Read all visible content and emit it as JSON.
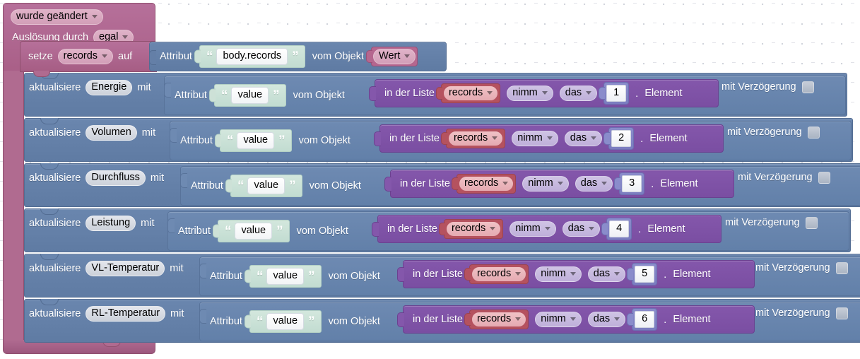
{
  "editor": {
    "type": "blockly-workspace",
    "language": "de",
    "grid_spacing_px": 28,
    "colors": {
      "hat_block": "#b06b90",
      "attribute_block": "#657fa8",
      "list_block": "#7d51a5",
      "text_shadow_block": "#c9e0d5",
      "number_shadow_block": "#8183c6",
      "variable_field": "#e5aab1",
      "background": "#ffffff"
    }
  },
  "trigger": {
    "event_label": "wurde geändert",
    "source_prefix": "Auslösung durch",
    "source_value": "egal"
  },
  "set_statement": {
    "prefix": "setze",
    "variable": "records",
    "suffix": "auf"
  },
  "attribute_source": {
    "prefix": "Attribut",
    "attribute_name": "body.records",
    "middle": "vom Objekt",
    "object_value": "Wert"
  },
  "common": {
    "update_prefix": "aktualisiere",
    "update_with": "mit",
    "attribute_label": "Attribut",
    "attribute_value": "value",
    "from_object": "vom Objekt",
    "list_prefix": "in der Liste",
    "list_variable": "records",
    "take": "nimm",
    "which": "das",
    "element_suffix": "Element",
    "dot": ".",
    "delay_label": "mit Verzögerung",
    "delay_checked": false
  },
  "rows": [
    {
      "target": "Energie",
      "index": "1"
    },
    {
      "target": "Volumen",
      "index": "2"
    },
    {
      "target": "Durchfluss",
      "index": "3"
    },
    {
      "target": "Leistung",
      "index": "4"
    },
    {
      "target": "VL-Temperatur",
      "index": "5"
    },
    {
      "target": "RL-Temperatur",
      "index": "6"
    }
  ]
}
